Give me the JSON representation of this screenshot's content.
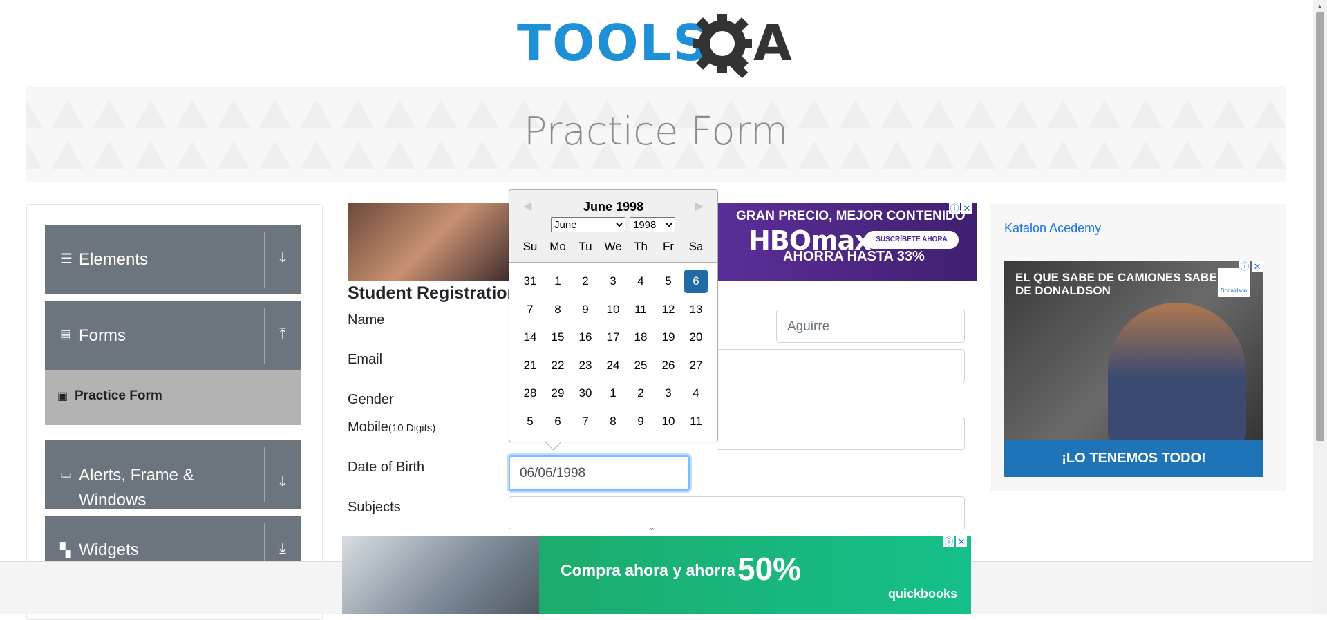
{
  "logo": {
    "text": "TOOLS",
    "suffix": "A"
  },
  "banner": {
    "title": "Practice Form"
  },
  "sidebar": {
    "groups": [
      {
        "label": "Elements",
        "icon": "menu-icon"
      },
      {
        "label": "Forms",
        "icon": "document-icon"
      },
      {
        "label": "Alerts, Frame &",
        "label2": "Windows",
        "icon": "window-icon"
      },
      {
        "label": "Widgets",
        "icon": "widgets-icon"
      }
    ],
    "active_item": "Practice Form"
  },
  "ad_top": {
    "line1": "GRAN PRECIO, MEJOR CONTENIDO",
    "brand": "HBOmax",
    "button": "SUSCRÍBETE AHORA",
    "line3": "AHORRA HASTA 33%"
  },
  "form": {
    "title": "Student Registration Form",
    "name_label": "Name",
    "last_name_placeholder": "Aguirre",
    "email_label": "Email",
    "gender_label": "Gender",
    "mobile_label": "Mobile",
    "mobile_hint": "(10 Digits)",
    "dob_label": "Date of Birth",
    "dob_value": "06/06/1998",
    "subjects_label": "Subjects"
  },
  "datepicker": {
    "month_year": "June 1998",
    "month_select": "June",
    "year_select": "1998",
    "weekdays": [
      "Su",
      "Mo",
      "Tu",
      "We",
      "Th",
      "Fr",
      "Sa"
    ],
    "weeks": [
      [
        "31",
        "1",
        "2",
        "3",
        "4",
        "5",
        "6"
      ],
      [
        "7",
        "8",
        "9",
        "10",
        "11",
        "12",
        "13"
      ],
      [
        "14",
        "15",
        "16",
        "17",
        "18",
        "19",
        "20"
      ],
      [
        "21",
        "22",
        "23",
        "24",
        "25",
        "26",
        "27"
      ],
      [
        "28",
        "29",
        "30",
        "1",
        "2",
        "3",
        "4"
      ],
      [
        "5",
        "6",
        "7",
        "8",
        "9",
        "10",
        "11"
      ]
    ],
    "selected": "6"
  },
  "right": {
    "katalon": "Katalon Acedemy",
    "ad_title": "EL QUE SABE DE CAMIONES SABE DE DONALDSON",
    "ad_bar": "¡LO TENEMOS TODO!",
    "ad_logo": "Donaldson"
  },
  "ad_bottom": {
    "text": "Compra ahora y ahorra",
    "pct": "50%",
    "brand": "quickbooks"
  },
  "colors": {
    "sidebar_group": "#6c757d",
    "active_item": "#b3b3b3",
    "selected_day": "#216ba5",
    "logo_blue": "#1e90d6"
  }
}
